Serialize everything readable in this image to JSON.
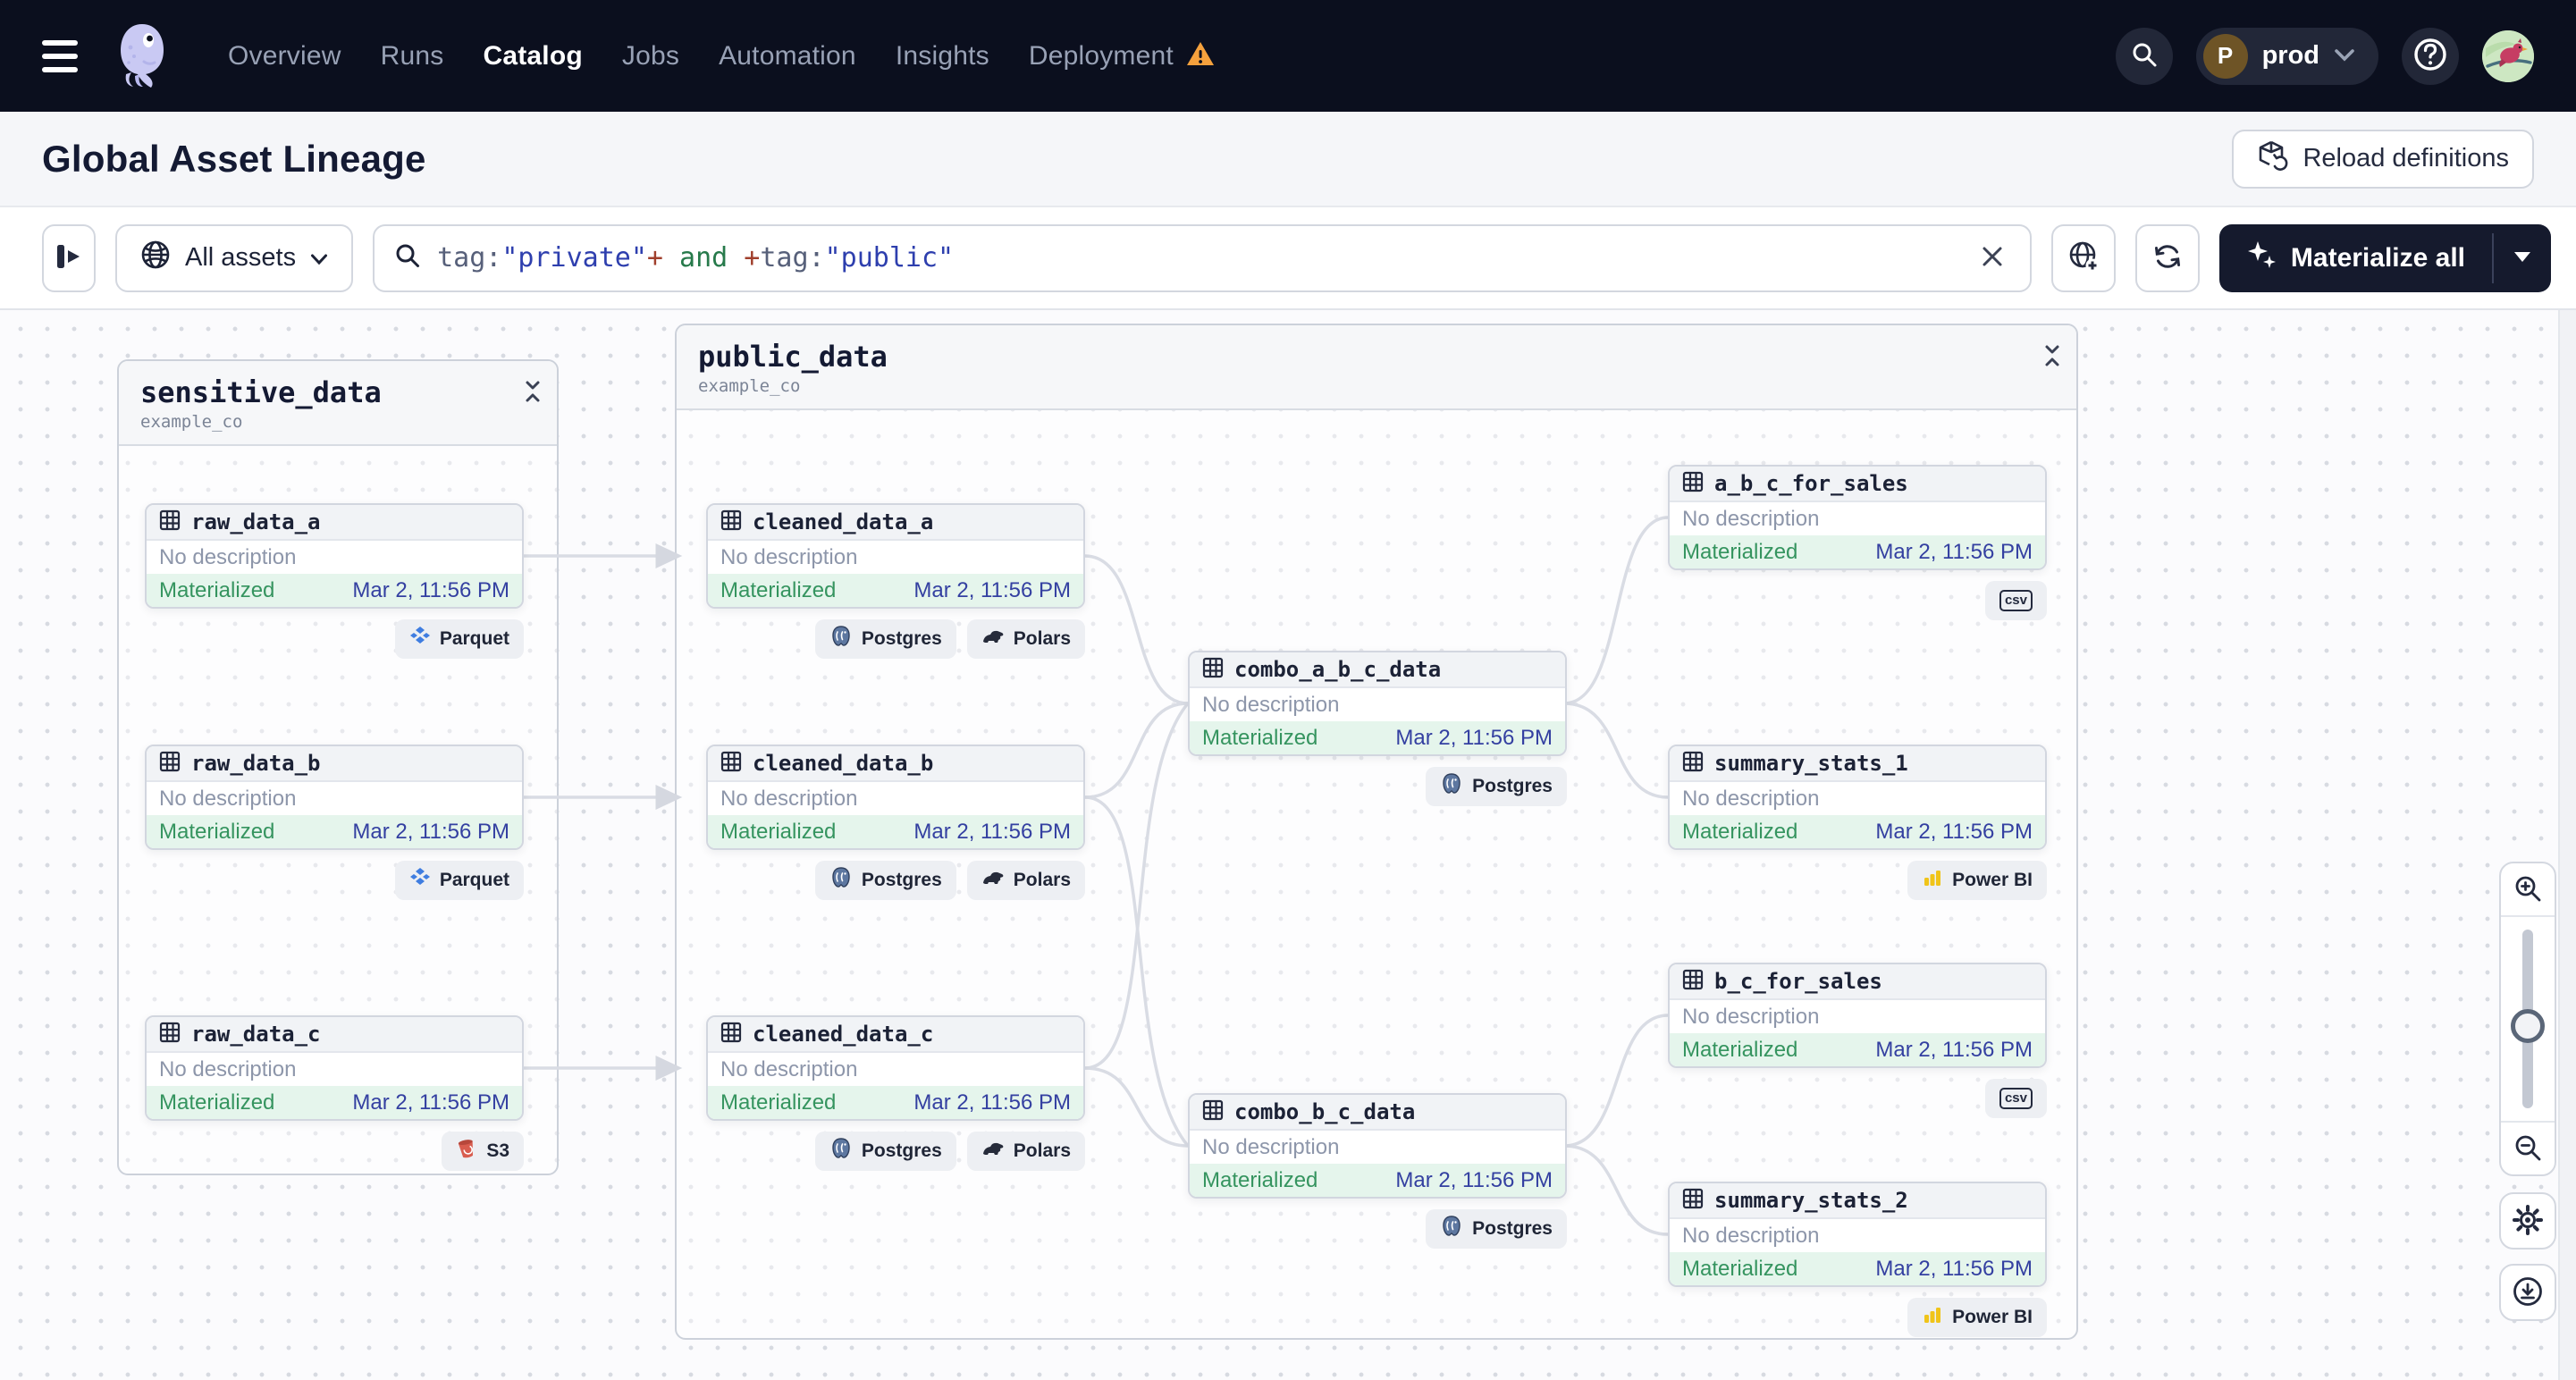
{
  "nav": {
    "items": [
      {
        "label": "Overview"
      },
      {
        "label": "Runs"
      },
      {
        "label": "Catalog",
        "active": true
      },
      {
        "label": "Jobs"
      },
      {
        "label": "Automation"
      },
      {
        "label": "Insights"
      },
      {
        "label": "Deployment",
        "warning": true
      }
    ],
    "env": {
      "initial": "P",
      "name": "prod"
    }
  },
  "header": {
    "title": "Global Asset Lineage",
    "reload_label": "Reload definitions"
  },
  "toolbar": {
    "scope_label": "All assets",
    "query_tokens": [
      "tag:",
      "\"private\"",
      "+",
      " and ",
      "+",
      "tag:",
      "\"public\""
    ],
    "materialize_label": "Materialize all"
  },
  "graph": {
    "groups": [
      {
        "name": "sensitive_data",
        "subtitle": "example_co"
      },
      {
        "name": "public_data",
        "subtitle": "example_co"
      }
    ],
    "nodes": [
      {
        "name": "raw_data_a",
        "desc": "No description",
        "status": "Materialized",
        "date": "Mar 2, 11:56 PM",
        "badges": [
          "Parquet"
        ]
      },
      {
        "name": "raw_data_b",
        "desc": "No description",
        "status": "Materialized",
        "date": "Mar 2, 11:56 PM",
        "badges": [
          "Parquet"
        ]
      },
      {
        "name": "raw_data_c",
        "desc": "No description",
        "status": "Materialized",
        "date": "Mar 2, 11:56 PM",
        "badges": [
          "S3"
        ]
      },
      {
        "name": "cleaned_data_a",
        "desc": "No description",
        "status": "Materialized",
        "date": "Mar 2, 11:56 PM",
        "badges": [
          "Postgres",
          "Polars"
        ]
      },
      {
        "name": "cleaned_data_b",
        "desc": "No description",
        "status": "Materialized",
        "date": "Mar 2, 11:56 PM",
        "badges": [
          "Postgres",
          "Polars"
        ]
      },
      {
        "name": "cleaned_data_c",
        "desc": "No description",
        "status": "Materialized",
        "date": "Mar 2, 11:56 PM",
        "badges": [
          "Postgres",
          "Polars"
        ]
      },
      {
        "name": "combo_a_b_c_data",
        "desc": "No description",
        "status": "Materialized",
        "date": "Mar 2, 11:56 PM",
        "badges": [
          "Postgres"
        ]
      },
      {
        "name": "a_b_c_for_sales",
        "desc": "No description",
        "status": "Materialized",
        "date": "Mar 2, 11:56 PM",
        "badges": [
          "csv"
        ]
      },
      {
        "name": "summary_stats_1",
        "desc": "No description",
        "status": "Materialized",
        "date": "Mar 2, 11:56 PM",
        "badges": [
          "Power BI"
        ]
      },
      {
        "name": "combo_b_c_data",
        "desc": "No description",
        "status": "Materialized",
        "date": "Mar 2, 11:56 PM",
        "badges": [
          "Postgres"
        ]
      },
      {
        "name": "b_c_for_sales",
        "desc": "No description",
        "status": "Materialized",
        "date": "Mar 2, 11:56 PM",
        "badges": [
          "csv"
        ]
      },
      {
        "name": "summary_stats_2",
        "desc": "No description",
        "status": "Materialized",
        "date": "Mar 2, 11:56 PM",
        "badges": [
          "Power BI"
        ]
      }
    ],
    "edges": [
      [
        "raw_data_a",
        "cleaned_data_a"
      ],
      [
        "raw_data_b",
        "cleaned_data_b"
      ],
      [
        "raw_data_c",
        "cleaned_data_c"
      ],
      [
        "cleaned_data_a",
        "combo_a_b_c_data"
      ],
      [
        "cleaned_data_b",
        "combo_a_b_c_data"
      ],
      [
        "cleaned_data_c",
        "combo_a_b_c_data"
      ],
      [
        "cleaned_data_b",
        "combo_b_c_data"
      ],
      [
        "cleaned_data_c",
        "combo_b_c_data"
      ],
      [
        "combo_a_b_c_data",
        "a_b_c_for_sales"
      ],
      [
        "combo_a_b_c_data",
        "summary_stats_1"
      ],
      [
        "combo_b_c_data",
        "b_c_for_sales"
      ],
      [
        "combo_b_c_data",
        "summary_stats_2"
      ]
    ]
  },
  "colors": {
    "nav_bg": "#0b0f1e",
    "materialize_bg": "#151a2d",
    "status_green": "#35945f",
    "status_bg": "#e5f5ec",
    "date_indigo": "#3440a1",
    "edge_gray": "#d9dce4",
    "warning_orange": "#f5a13d"
  }
}
